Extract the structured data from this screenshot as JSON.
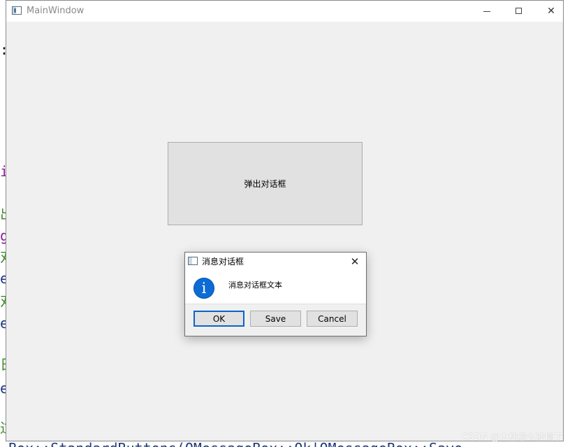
{
  "main_window": {
    "title": "MainWindow",
    "popup_button_label": "弹出对话框"
  },
  "message_box": {
    "title": "消息对话框",
    "text": "消息对话框文本",
    "buttons": [
      "OK",
      "Save",
      "Cancel"
    ]
  },
  "background_code": {
    "fragments": [
      ":",
      "i",
      "出",
      "g",
      "对",
      "e",
      "对",
      "e",
      "日",
      "e",
      "过"
    ],
    "bottom_line": "Box::StandardButtons(QMessageBox::Ok|QMessageBox::Save"
  },
  "watermark": "CSDN @大柏怎么被偷了",
  "colors": {
    "window_bg": "#f0f0f0",
    "button_face": "#e1e1e1",
    "info_icon": "#0d6cd3",
    "default_button_border": "#0a64c8"
  },
  "icons": {
    "app": "qt-window-icon",
    "info": "info-icon",
    "minimize": "minimize-icon",
    "maximize": "maximize-icon",
    "close": "close-icon"
  }
}
